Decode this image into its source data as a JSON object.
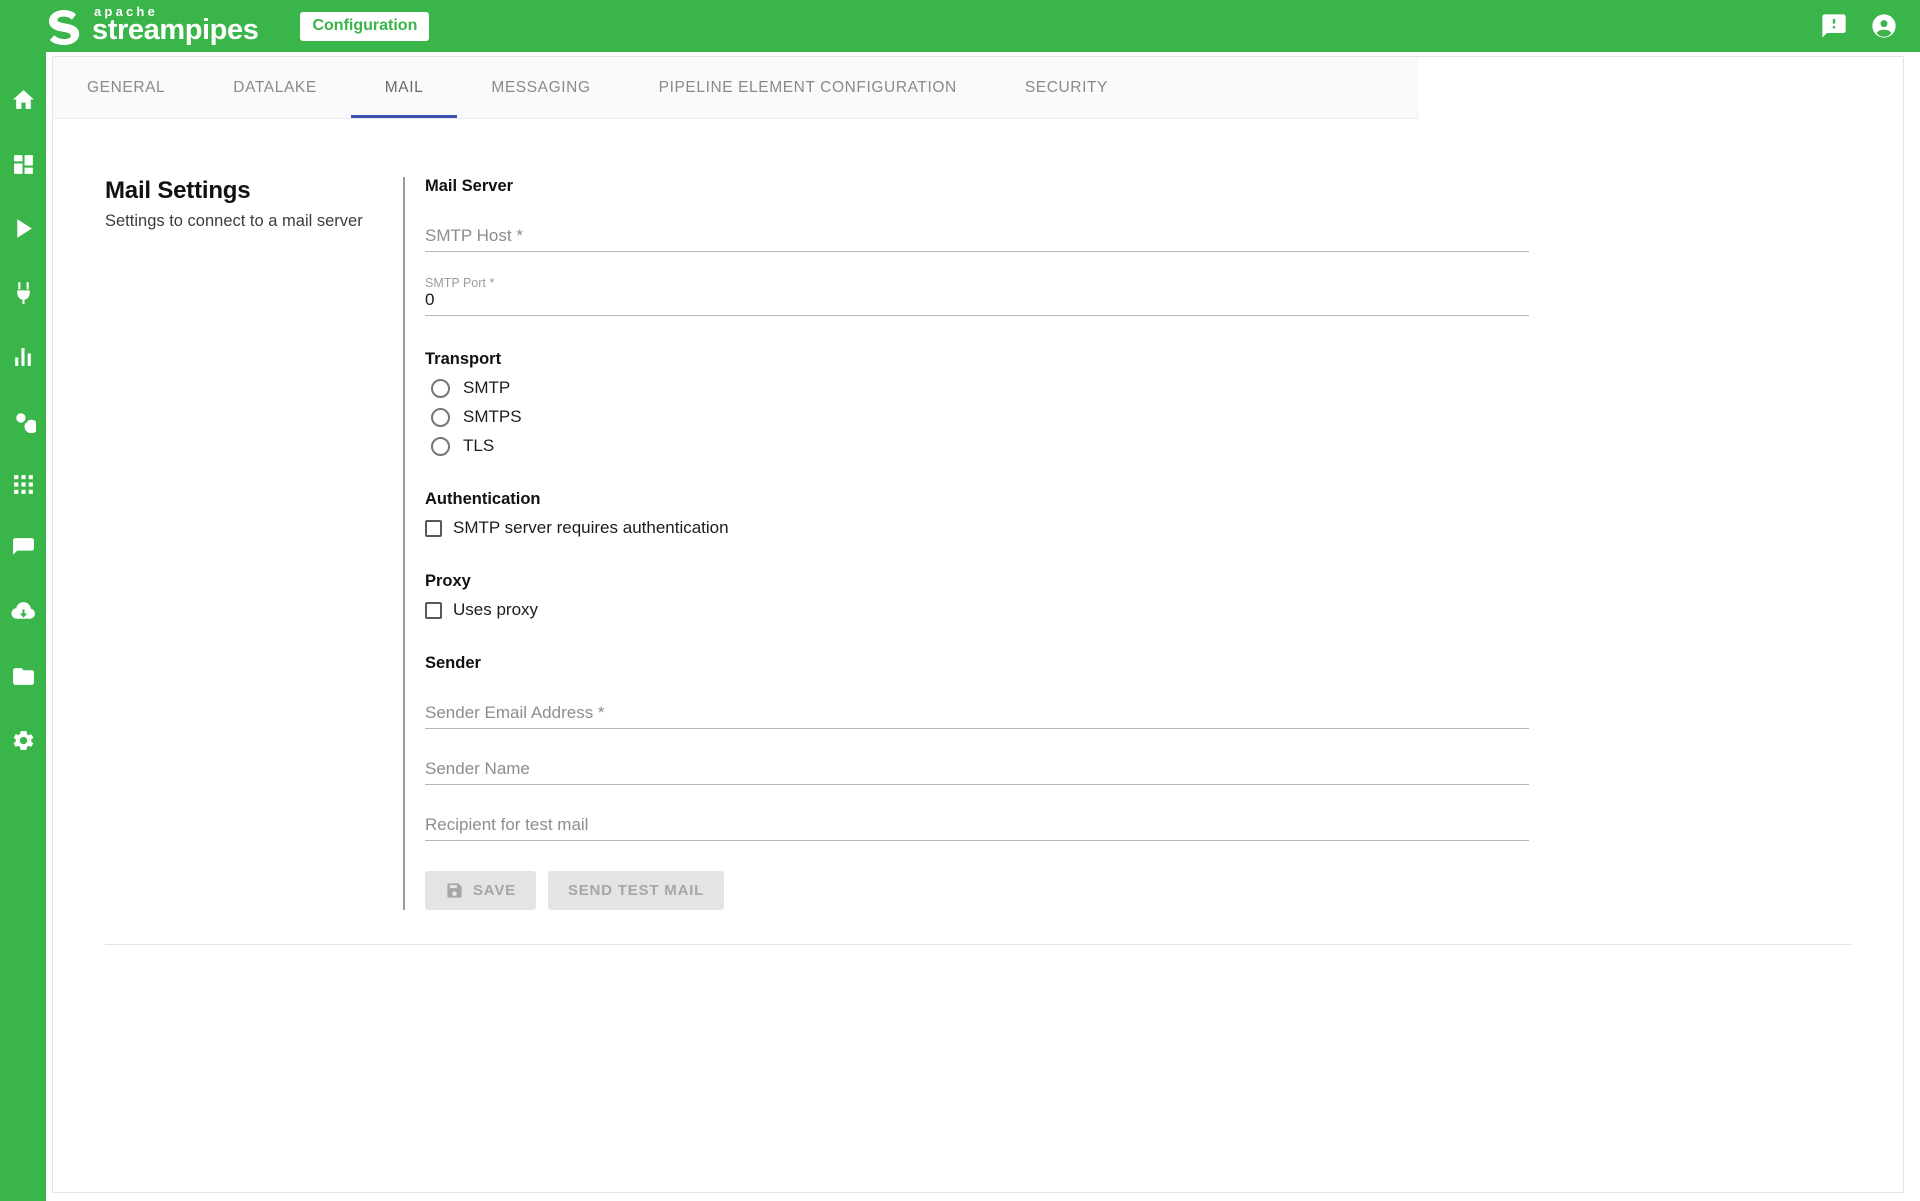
{
  "header": {
    "brand_apache": "apache",
    "brand_name": "streampipes",
    "badge": "Configuration",
    "brand_color": "#39b54a",
    "icons": [
      {
        "name": "alert-message-icon"
      },
      {
        "name": "account-circle-icon"
      }
    ]
  },
  "sidebar": {
    "items": [
      {
        "name": "home-icon"
      },
      {
        "name": "dashboard-icon"
      },
      {
        "name": "pipelines-play-icon"
      },
      {
        "name": "connect-plug-icon"
      },
      {
        "name": "chart-bar-icon"
      },
      {
        "name": "search-icon"
      },
      {
        "name": "apps-grid-icon"
      },
      {
        "name": "notifications-chat-icon"
      },
      {
        "name": "download-cloud-icon"
      },
      {
        "name": "files-folder-icon"
      },
      {
        "name": "settings-gear-icon"
      }
    ]
  },
  "tabs": [
    {
      "label": "GENERAL",
      "active": false
    },
    {
      "label": "DATALAKE",
      "active": false
    },
    {
      "label": "MAIL",
      "active": true
    },
    {
      "label": "MESSAGING",
      "active": false
    },
    {
      "label": "PIPELINE ELEMENT CONFIGURATION",
      "active": false
    },
    {
      "label": "SECURITY",
      "active": false
    }
  ],
  "active_tab_indicator_color": "#3f51b5",
  "settings": {
    "title": "Mail Settings",
    "subtitle": "Settings to connect to a mail server",
    "mail_server": {
      "heading": "Mail Server",
      "smtp_host": {
        "label": "SMTP Host *",
        "value": "",
        "placeholder": "SMTP Host *"
      },
      "smtp_port": {
        "label": "SMTP Port *",
        "value": "0"
      }
    },
    "transport": {
      "heading": "Transport",
      "options": [
        {
          "label": "SMTP",
          "selected": false
        },
        {
          "label": "SMTPS",
          "selected": false
        },
        {
          "label": "TLS",
          "selected": false
        }
      ]
    },
    "authentication": {
      "heading": "Authentication",
      "checkbox_label": "SMTP server requires authentication",
      "checked": false
    },
    "proxy": {
      "heading": "Proxy",
      "checkbox_label": "Uses proxy",
      "checked": false
    },
    "sender": {
      "heading": "Sender",
      "email": {
        "label": "Sender Email Address *",
        "value": "",
        "placeholder": "Sender Email Address *"
      },
      "name": {
        "label": "Sender Name",
        "value": "",
        "placeholder": "Sender Name"
      },
      "recipient": {
        "label": "Recipient for test mail",
        "value": "",
        "placeholder": "Recipient for test mail"
      }
    },
    "actions": {
      "save_label": "SAVE",
      "save_icon": "save-disk-icon",
      "save_disabled": true,
      "test_label": "SEND TEST MAIL",
      "test_disabled": true
    }
  }
}
